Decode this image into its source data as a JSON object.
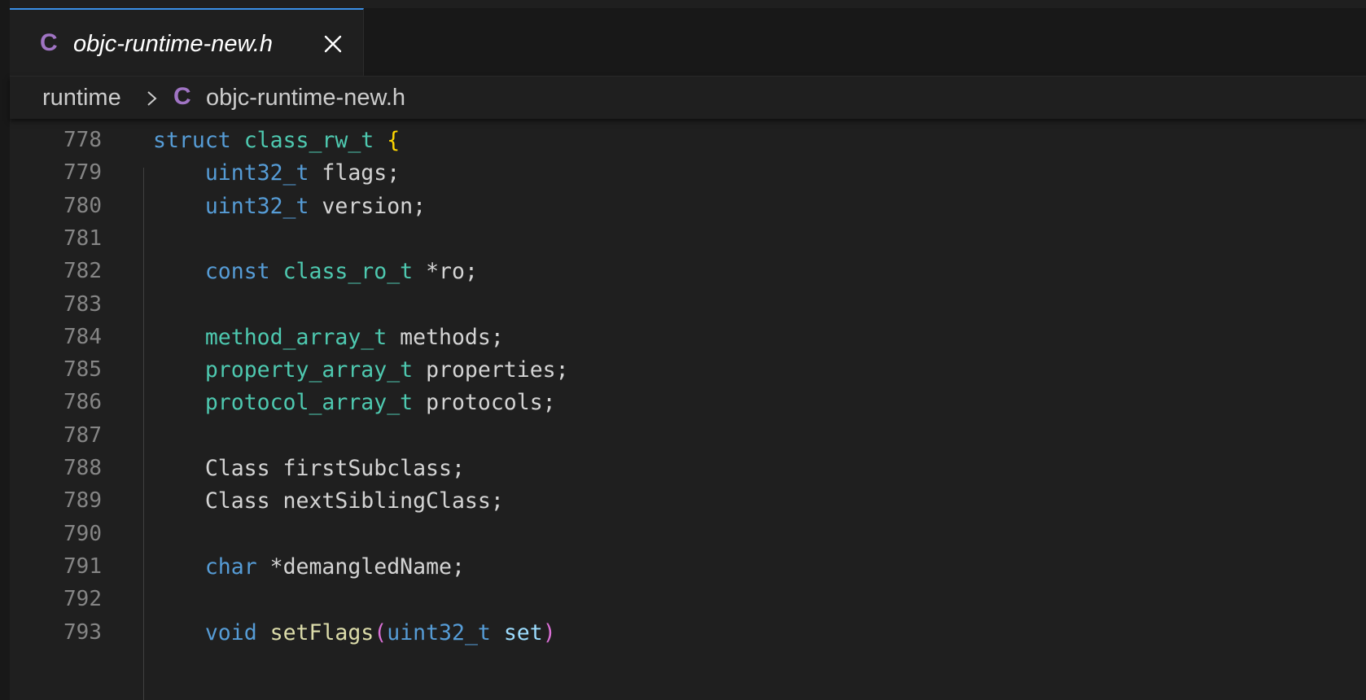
{
  "tab": {
    "icon": "C",
    "label": "objc-runtime-new.h",
    "close_icon": "close-icon"
  },
  "breadcrumb": {
    "root": "runtime",
    "icon": "C",
    "file": "objc-runtime-new.h"
  },
  "colors": {
    "background": "#1f1f1f",
    "tab_active_border": "#3a8ee6",
    "c_file_icon": "#a074c4",
    "keyword": "#569cd6",
    "type": "#4ec9b0",
    "function": "#dcdcaa",
    "parameter": "#9cdcfe",
    "brace": "#ffd700",
    "paren": "#da70d6",
    "line_number": "#858585"
  },
  "lines": [
    {
      "num": "778",
      "tokens": [
        {
          "t": "struct",
          "c": "kw"
        },
        {
          "t": " ",
          "c": "plain"
        },
        {
          "t": "class_rw_t",
          "c": "type"
        },
        {
          "t": " ",
          "c": "plain"
        },
        {
          "t": "{",
          "c": "brace"
        }
      ]
    },
    {
      "num": "779",
      "tokens": [
        {
          "t": "    ",
          "c": "plain"
        },
        {
          "t": "uint32_t",
          "c": "kw"
        },
        {
          "t": " flags;",
          "c": "plain"
        }
      ]
    },
    {
      "num": "780",
      "tokens": [
        {
          "t": "    ",
          "c": "plain"
        },
        {
          "t": "uint32_t",
          "c": "kw"
        },
        {
          "t": " version;",
          "c": "plain"
        }
      ]
    },
    {
      "num": "781",
      "tokens": []
    },
    {
      "num": "782",
      "tokens": [
        {
          "t": "    ",
          "c": "plain"
        },
        {
          "t": "const",
          "c": "kw"
        },
        {
          "t": " ",
          "c": "plain"
        },
        {
          "t": "class_ro_t",
          "c": "type"
        },
        {
          "t": " *ro;",
          "c": "plain"
        }
      ]
    },
    {
      "num": "783",
      "tokens": []
    },
    {
      "num": "784",
      "tokens": [
        {
          "t": "    ",
          "c": "plain"
        },
        {
          "t": "method_array_t",
          "c": "type"
        },
        {
          "t": " methods;",
          "c": "plain"
        }
      ]
    },
    {
      "num": "785",
      "tokens": [
        {
          "t": "    ",
          "c": "plain"
        },
        {
          "t": "property_array_t",
          "c": "type"
        },
        {
          "t": " properties;",
          "c": "plain"
        }
      ]
    },
    {
      "num": "786",
      "tokens": [
        {
          "t": "    ",
          "c": "plain"
        },
        {
          "t": "protocol_array_t",
          "c": "type"
        },
        {
          "t": " protocols;",
          "c": "plain"
        }
      ]
    },
    {
      "num": "787",
      "tokens": []
    },
    {
      "num": "788",
      "tokens": [
        {
          "t": "    Class firstSubclass;",
          "c": "plain"
        }
      ]
    },
    {
      "num": "789",
      "tokens": [
        {
          "t": "    Class nextSiblingClass;",
          "c": "plain"
        }
      ]
    },
    {
      "num": "790",
      "tokens": []
    },
    {
      "num": "791",
      "tokens": [
        {
          "t": "    ",
          "c": "plain"
        },
        {
          "t": "char",
          "c": "kw"
        },
        {
          "t": " *demangledName;",
          "c": "plain"
        }
      ]
    },
    {
      "num": "792",
      "tokens": []
    },
    {
      "num": "793",
      "tokens": [
        {
          "t": "    ",
          "c": "plain"
        },
        {
          "t": "void",
          "c": "kw"
        },
        {
          "t": " ",
          "c": "plain"
        },
        {
          "t": "setFlags",
          "c": "fn"
        },
        {
          "t": "(",
          "c": "paren"
        },
        {
          "t": "uint32_t",
          "c": "kw"
        },
        {
          "t": " ",
          "c": "plain"
        },
        {
          "t": "set",
          "c": "param"
        },
        {
          "t": ")",
          "c": "paren"
        }
      ]
    }
  ]
}
